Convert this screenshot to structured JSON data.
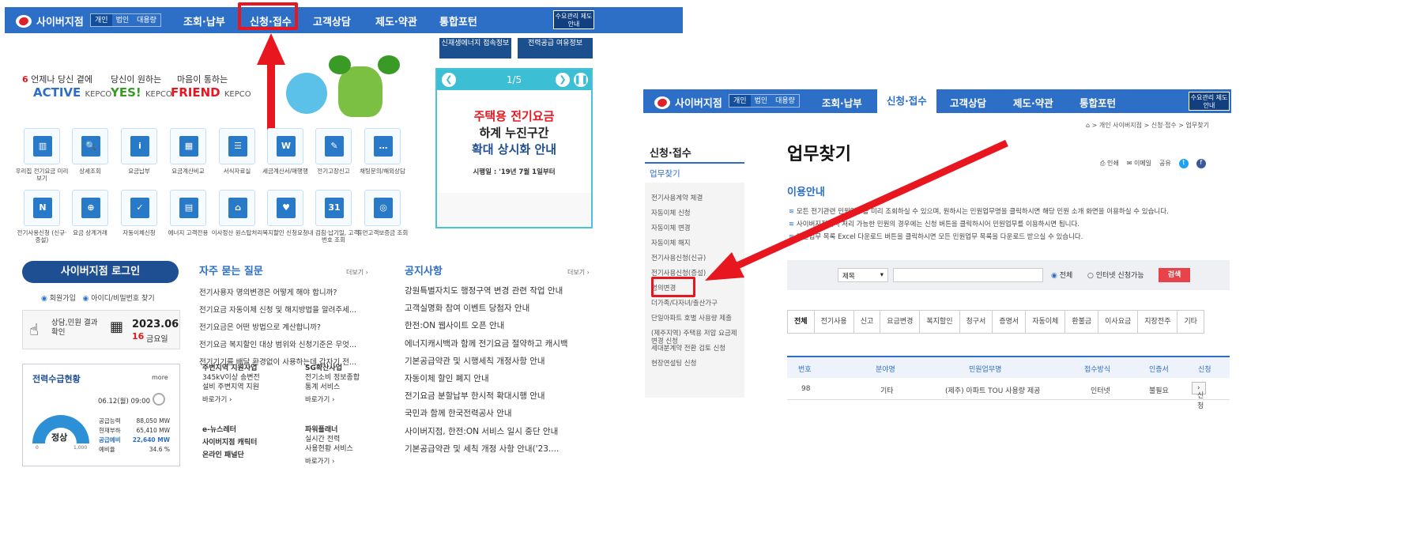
{
  "colors": {
    "brand_blue": "#2d6fc7",
    "dark_blue": "#1f4f93",
    "highlight_red": "#e8171f",
    "notice_cyan": "#3cbfd4"
  },
  "left": {
    "logo_text": "사이버지점",
    "user_types": [
      "개인",
      "법인",
      "대용량"
    ],
    "nav": [
      "조회·납부",
      "신청·접수",
      "고객상담",
      "제도·약관",
      "통합포턴"
    ],
    "nav_highlighted": "신청·접수",
    "demand_box": "수요관리 제도안내",
    "sub_buttons": [
      "신재생에너지 접속정보",
      "전력공급 여유정보"
    ],
    "slogans": [
      {
        "top": "언제나 당신 곁에",
        "main": "ACTIVE",
        "brand": "KEPCO"
      },
      {
        "top": "당신이 원하는",
        "main": "YES!",
        "brand": "KEPCO"
      },
      {
        "top": "마음이 통하는",
        "main": "FRIEND",
        "brand": "KEPCO"
      }
    ],
    "notice": {
      "page": "1/5",
      "line1": "주택용 전기요금",
      "line2": "하계 누진구간",
      "line3": "확대 상시화 안내",
      "date": "시행일 : '19년 7월 1일부터"
    },
    "tiles_row1": [
      {
        "label": "우리집 전기요금 미리보기",
        "glyph": "▥"
      },
      {
        "label": "상세조회",
        "glyph": "🔍"
      },
      {
        "label": "요금납부",
        "glyph": "i"
      },
      {
        "label": "요금계산비교",
        "glyph": "▦"
      },
      {
        "label": "서식자료실",
        "glyph": "☰"
      },
      {
        "label": "세금계산서/매행행",
        "glyph": "W"
      },
      {
        "label": "전기고장신고",
        "glyph": "✎"
      },
      {
        "label": "채팅문의/해외상담",
        "glyph": "…"
      }
    ],
    "tiles_row2": [
      {
        "label": "전기사용신청 (신규·증설)",
        "glyph": "N"
      },
      {
        "label": "요금 상계거래",
        "glyph": "⊕"
      },
      {
        "label": "자동이체신청",
        "glyph": "✓"
      },
      {
        "label": "에너지 고객전용",
        "glyph": "▤"
      },
      {
        "label": "이사정산 원스탑처리",
        "glyph": "⌂"
      },
      {
        "label": "복지할인 신청요청",
        "glyph": "♥"
      },
      {
        "label": "내 검침·납기일, 고객번호 조회",
        "glyph": "31"
      },
      {
        "label": "휴먼고객보증금 조회",
        "glyph": "◎"
      }
    ],
    "login": {
      "button": "사이버지점 로그인",
      "join": "회원가입",
      "find": "아이디/비밀번호 찾기"
    },
    "status": {
      "label": "상담,민원 결과 확인",
      "date": "2023.06",
      "day": "16",
      "weekday": "금요일"
    },
    "faq": {
      "title": "자주 묻는 질문",
      "more": "더보기",
      "items": [
        "전기사용자 명의변경은 어떻게 해야 합니까?",
        "전기요금 자동이체 신청 및 해지방법을 알려주세...",
        "전기요금은 어떤 방법으로 계산합니까?",
        "전기요금 복지할인 대상 범위와 신청기준은 무엇...",
        "전기기기를 배달 환경없이 사용하는데 갑자기 전..."
      ]
    },
    "notices": {
      "title": "공지사항",
      "more": "더보기",
      "items": [
        "강원특별자치도 행정구역 변경 관련 작업 안내",
        "고객실명화 참여 이벤트 당첨자 안내",
        "한전:ON 웹사이트 오픈 안내",
        "에너지캐시백과 함께 전기요금 절약하고 캐시백",
        "기본공급약관 및 시행세칙 개정사항 안내",
        "자동이체 할인 폐지 안내",
        "전기요금 분할납부 한시적 확대시행 안내",
        "국민과 함께 한국전력공사 안내",
        "사이버지점, 한전:ON 서비스 일시 중단 안내",
        "기본공급약관 및 세칙 개정 사항 안내('23...."
      ]
    },
    "power": {
      "title": "전력수급현황",
      "more": "more",
      "timestamp": "06.12(월) 09:00",
      "state": "정상",
      "gauge_min": "0",
      "gauge_max": "1,000",
      "rows": [
        {
          "k": "공급능력",
          "v": "88,050 MW"
        },
        {
          "k": "현재부하",
          "v": "65,410 MW"
        },
        {
          "k": "공급예비",
          "v": "22,640 MW"
        },
        {
          "k": "예비율",
          "v": "34.6 %"
        }
      ]
    },
    "projects": [
      {
        "title": "주변지역 지원사업",
        "lines": [
          "345kV이상 송변전",
          "설비 주변지역 지원"
        ],
        "more": "바로가기"
      },
      {
        "title": "SG확산사업",
        "lines": [
          "전기소비 정보종합",
          "통계 서비스"
        ],
        "more": "바로가기"
      },
      {
        "title": "e-뉴스레터",
        "lines": [
          "사이버지점 캐릭터",
          "온라인 패널단"
        ],
        "more": ""
      },
      {
        "title": "파워플래너",
        "lines": [
          "실시간 전력",
          "사용현황 서비스"
        ],
        "more": "바로가기"
      }
    ]
  },
  "right": {
    "logo_text": "사이버지점",
    "user_types": [
      "개인",
      "법인",
      "대용량"
    ],
    "nav": [
      "조회·납부",
      "신청·접수",
      "고객상담",
      "제도·약관",
      "통합포턴"
    ],
    "nav_active": "신청·접수",
    "demand_box": "수요관리 제도안내",
    "breadcrumb": "⌂ > 개인 사이버지점 > 신청·접수 > 업무찾기",
    "side_title": "신청·접수",
    "side_active": "업무찾기",
    "side_items": [
      "전기사용계약 체결",
      "자동이체 신청",
      "자동이체 변경",
      "자동이체 해지",
      "전기사용신청(신규)",
      "전기사용신청(증설)",
      "명의변경",
      "더가족/다자녀/출산가구",
      "단일아파트 호별 사용량 제출",
      "(제주지역) 주택용 저압 요금제 변경 신청",
      "세대분계약 전환 검토 신청",
      "현장연설팅 신청"
    ],
    "side_highlighted": "명의변경",
    "title": "업무찾기",
    "share": [
      "인쇄",
      "이메일",
      "공유"
    ],
    "guide_title": "이용안내",
    "guide_lines": [
      "모든 전기관련 민원업무를 미리 조회하실 수 있으며, 원하시는 민원업무명을 클릭하시면 해당 민원 소개 화면을 이용하실 수 있습니다.",
      "사이버지점에서 처리 가능한 민원의 경우에는 신청 버튼을 클릭하시어 민원업무를 이용하시면 됩니다.",
      "민원업무 목록 Excel 다운로드 버튼을 클릭하시면 모든 민원업무 목록을 다운로드 받으실 수 있습니다."
    ],
    "search": {
      "select": "제목",
      "value": "",
      "radio_all": "전체",
      "radio_online": "인터넷 신청가능",
      "button": "검색"
    },
    "tabs": [
      "전체",
      "전기사용",
      "신고",
      "요금변경",
      "복지할인",
      "청구서",
      "증명서",
      "자동이체",
      "환불금",
      "이사요금",
      "지장전주",
      "기타"
    ],
    "table_headers": [
      "번호",
      "분야명",
      "민원업무명",
      "접수방식",
      "인증서",
      "신청"
    ],
    "table_row": {
      "no": "98",
      "field": "기타",
      "name": "(제주) 아파트 TOU 사용량 제공",
      "method": "인터넷",
      "cert": "불필요",
      "apply": "신청"
    }
  }
}
